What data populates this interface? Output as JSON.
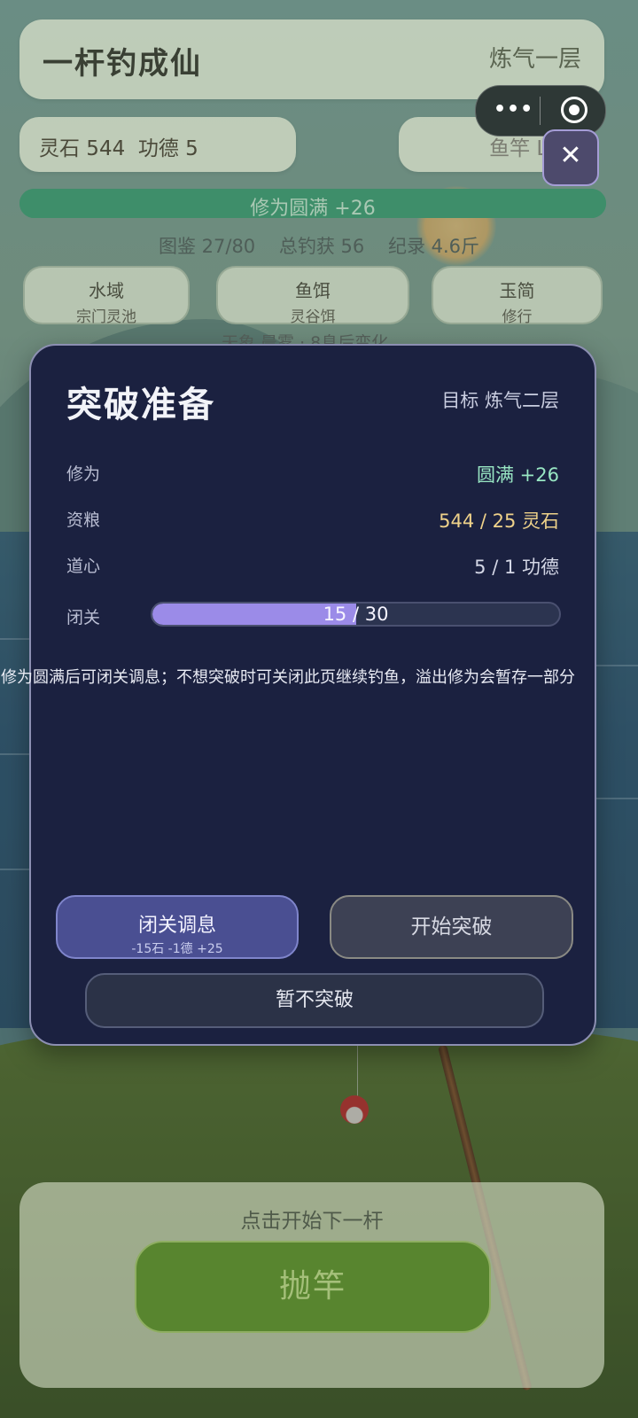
{
  "header": {
    "title": "一杆钓成仙",
    "realm": "炼气一层",
    "resources": "灵石 544  功德 5",
    "rod": "鱼竿 Lv.3",
    "cultivation_bar": "修为圆满 +26"
  },
  "stats": {
    "collection": "图鉴 27/80",
    "total_catch": "总钓获 56",
    "record": "纪录 4.6斤"
  },
  "selectors": [
    {
      "title": "水域",
      "value": "宗门灵池"
    },
    {
      "title": "鱼饵",
      "value": "灵谷饵"
    },
    {
      "title": "玉简",
      "value": "修行"
    }
  ],
  "weather_text": "天象 晨雾 · 8息后变化",
  "miniprogram": {
    "more_icon": "more-dots-icon",
    "exit_icon": "target-icon",
    "close_icon": "close-icon"
  },
  "modal": {
    "title": "突破准备",
    "target": "目标 炼气二层",
    "rows": [
      {
        "label": "修为",
        "value": "圆满 +26"
      },
      {
        "label": "资粮",
        "value": "544 / 25 灵石"
      },
      {
        "label": "道心",
        "value": "5 / 1 功德"
      }
    ],
    "seclusion": {
      "label": "闭关",
      "text": "15 / 30",
      "current": 15,
      "total": 30
    },
    "hint": "修为圆满后可闭关调息；不想突破时可关闭此页继续钓鱼，溢出修为会暂存一部分",
    "rest_button": {
      "label": "闭关调息",
      "sub": "-15石 -1德 +25"
    },
    "breakthrough_button": "开始突破",
    "skip_button": "暂不突破"
  },
  "bottom": {
    "hint": "点击开始下一杆",
    "cast_button": "抛竿"
  },
  "colors": {
    "modal_bg": "#1b2140",
    "progress_fill": "#9b8be8",
    "cultivation_green": "#98e6c3",
    "resource_gold": "#efd28a",
    "rest_button": "#4a4f92",
    "cast_button": "#58852f"
  }
}
